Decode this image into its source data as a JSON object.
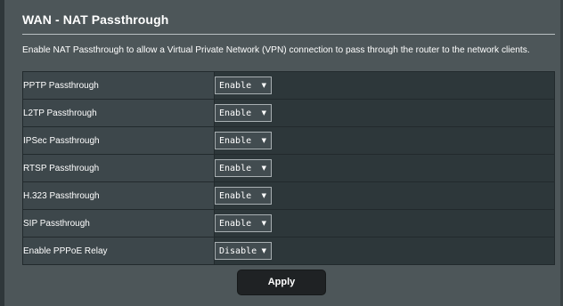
{
  "header": {
    "title": "WAN - NAT Passthrough"
  },
  "description": "Enable NAT Passthrough to allow a Virtual Private Network (VPN) connection to pass through the router to the network clients.",
  "settings": {
    "rows": [
      {
        "label": "PPTP Passthrough",
        "value": "Enable"
      },
      {
        "label": "L2TP Passthrough",
        "value": "Enable"
      },
      {
        "label": "IPSec Passthrough",
        "value": "Enable"
      },
      {
        "label": "RTSP Passthrough",
        "value": "Enable"
      },
      {
        "label": "H.323 Passthrough",
        "value": "Enable"
      },
      {
        "label": "SIP Passthrough",
        "value": "Enable"
      },
      {
        "label": "Enable PPPoE Relay",
        "value": "Disable"
      }
    ]
  },
  "actions": {
    "apply_label": "Apply"
  },
  "icons": {
    "dropdown": "chevron-down-icon"
  },
  "colors": {
    "background": "#4d5659",
    "label_cell": "#3d474b",
    "control_cell": "#2d373a",
    "button": "#1f2224",
    "text": "#ffffff"
  }
}
